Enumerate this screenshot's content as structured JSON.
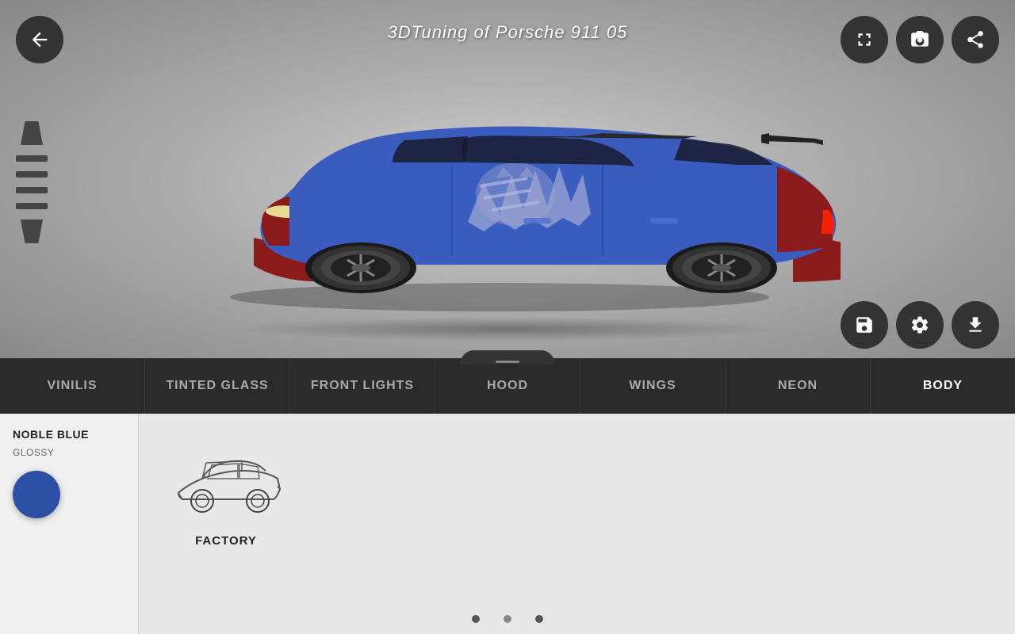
{
  "header": {
    "title": "3DTuning of Porsche 911 05"
  },
  "buttons": {
    "back_label": "←",
    "fullscreen_label": "⛶",
    "camera_label": "📷",
    "share_label": "↗",
    "save_label": "💾",
    "settings_label": "⚙",
    "download_label": "⬇"
  },
  "nav": {
    "items": [
      {
        "id": "vinilis",
        "label": "VINILIS",
        "active": false
      },
      {
        "id": "tinted-glass",
        "label": "TINTED GLASS",
        "active": false
      },
      {
        "id": "front-lights",
        "label": "FRONT LIGHTS",
        "active": false
      },
      {
        "id": "hood",
        "label": "HOOD",
        "active": false
      },
      {
        "id": "wings",
        "label": "WINGS",
        "active": false
      },
      {
        "id": "neon",
        "label": "NEON",
        "active": false
      },
      {
        "id": "body",
        "label": "BODY",
        "active": true
      }
    ]
  },
  "color_panel": {
    "name": "NOBLE BLUE",
    "finish": "GLOSSY",
    "color_hex": "#2c4fa3"
  },
  "options": [
    {
      "id": "factory",
      "label": "FACTORY"
    }
  ],
  "dots": [
    {
      "id": 1,
      "active": false
    },
    {
      "id": 2,
      "active": true
    },
    {
      "id": 3,
      "active": false
    }
  ]
}
